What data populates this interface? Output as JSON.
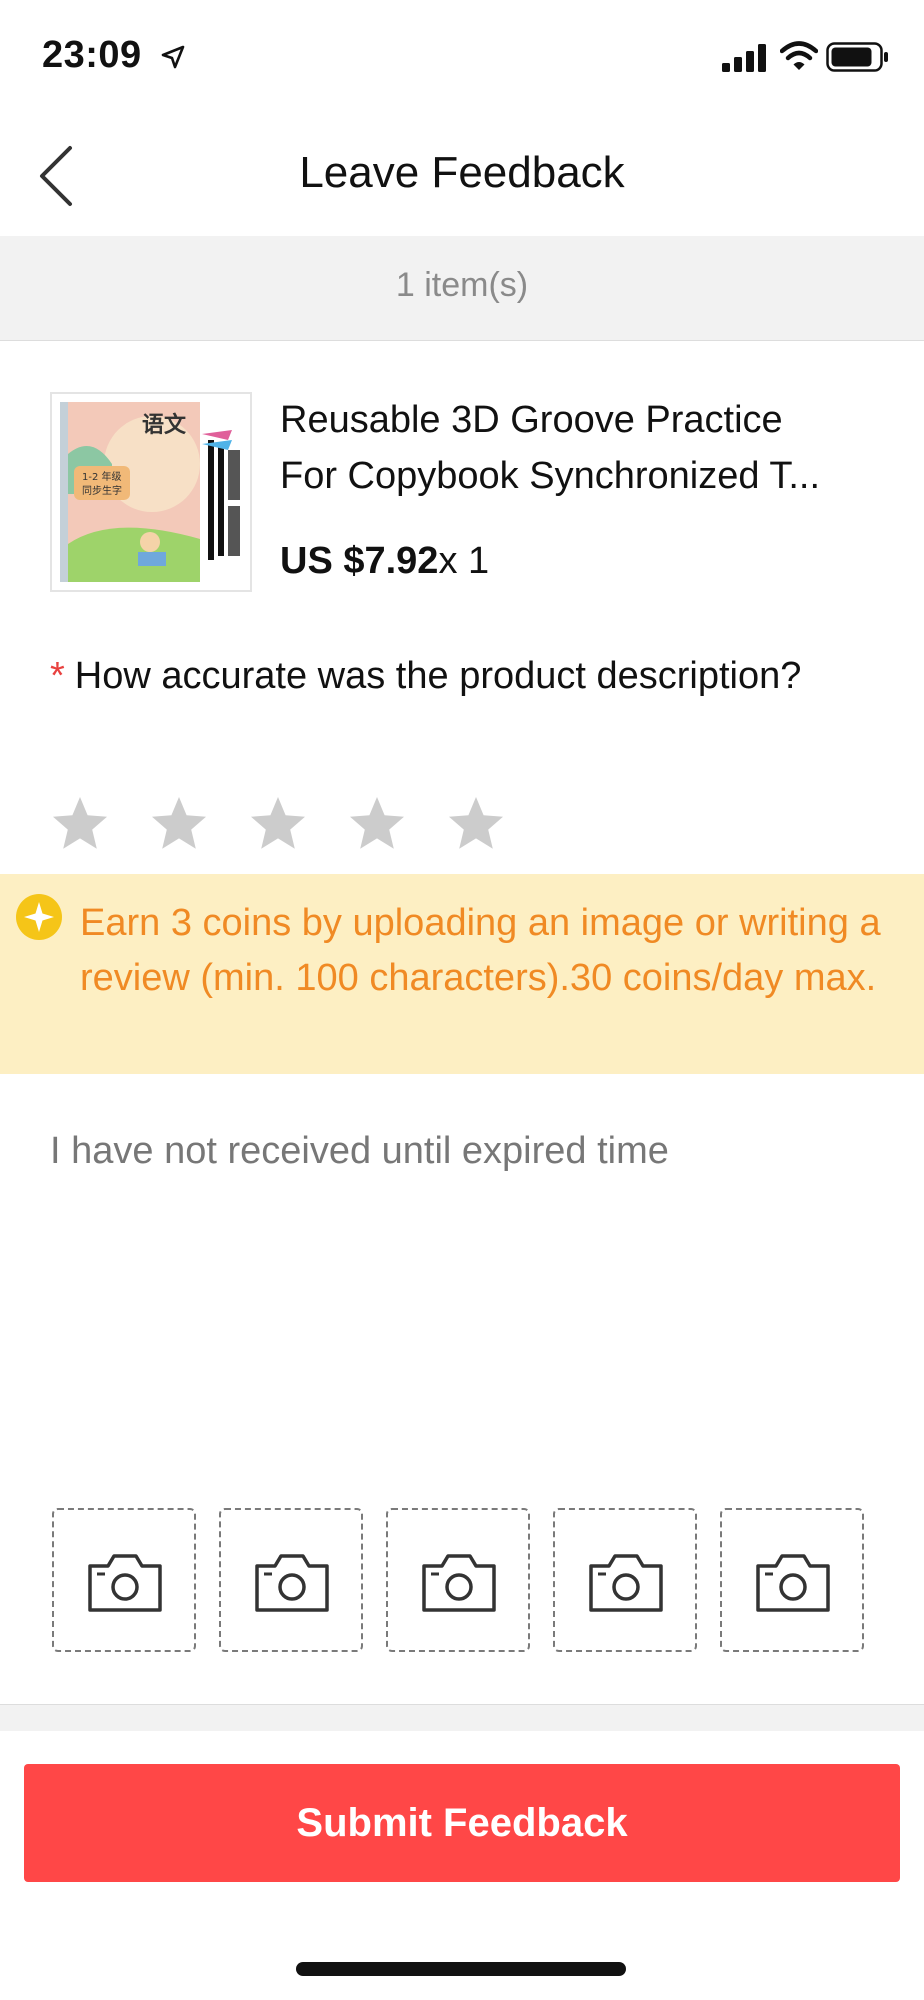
{
  "status_bar": {
    "time": "23:09",
    "icons": [
      "location-arrow-icon",
      "cellular-signal-icon",
      "wifi-icon",
      "battery-icon"
    ]
  },
  "header": {
    "title": "Leave Feedback",
    "back_icon": "chevron-left-icon"
  },
  "items": {
    "count_label": "1 item(s)"
  },
  "product": {
    "title_line1": "Reusable 3D Groove Practice",
    "title_line2": "For Copybook Synchronized T...",
    "price": "US $7.92",
    "quantity": "x 1"
  },
  "question": {
    "required_mark": "*",
    "text": "How accurate was the product description?",
    "stars_total": 5,
    "rating": 0
  },
  "coins_banner": {
    "icon": "coin-star-icon",
    "text": "Earn 3 coins by uploading an image or writing a review (min. 100 characters).30 coins/day max."
  },
  "review": {
    "text": "I have not received until expired time"
  },
  "uploads": {
    "slots": 5,
    "icon": "camera-icon"
  },
  "submit": {
    "label": "Submit Feedback"
  },
  "colors": {
    "accent_red": "#ff4747",
    "required_red": "#e8413f",
    "banner_bg": "#fdefc3",
    "banner_text": "#f08a24",
    "coin_yellow": "#f5c518",
    "star_gray": "#cccccc",
    "band_gray": "#f2f2f2"
  }
}
